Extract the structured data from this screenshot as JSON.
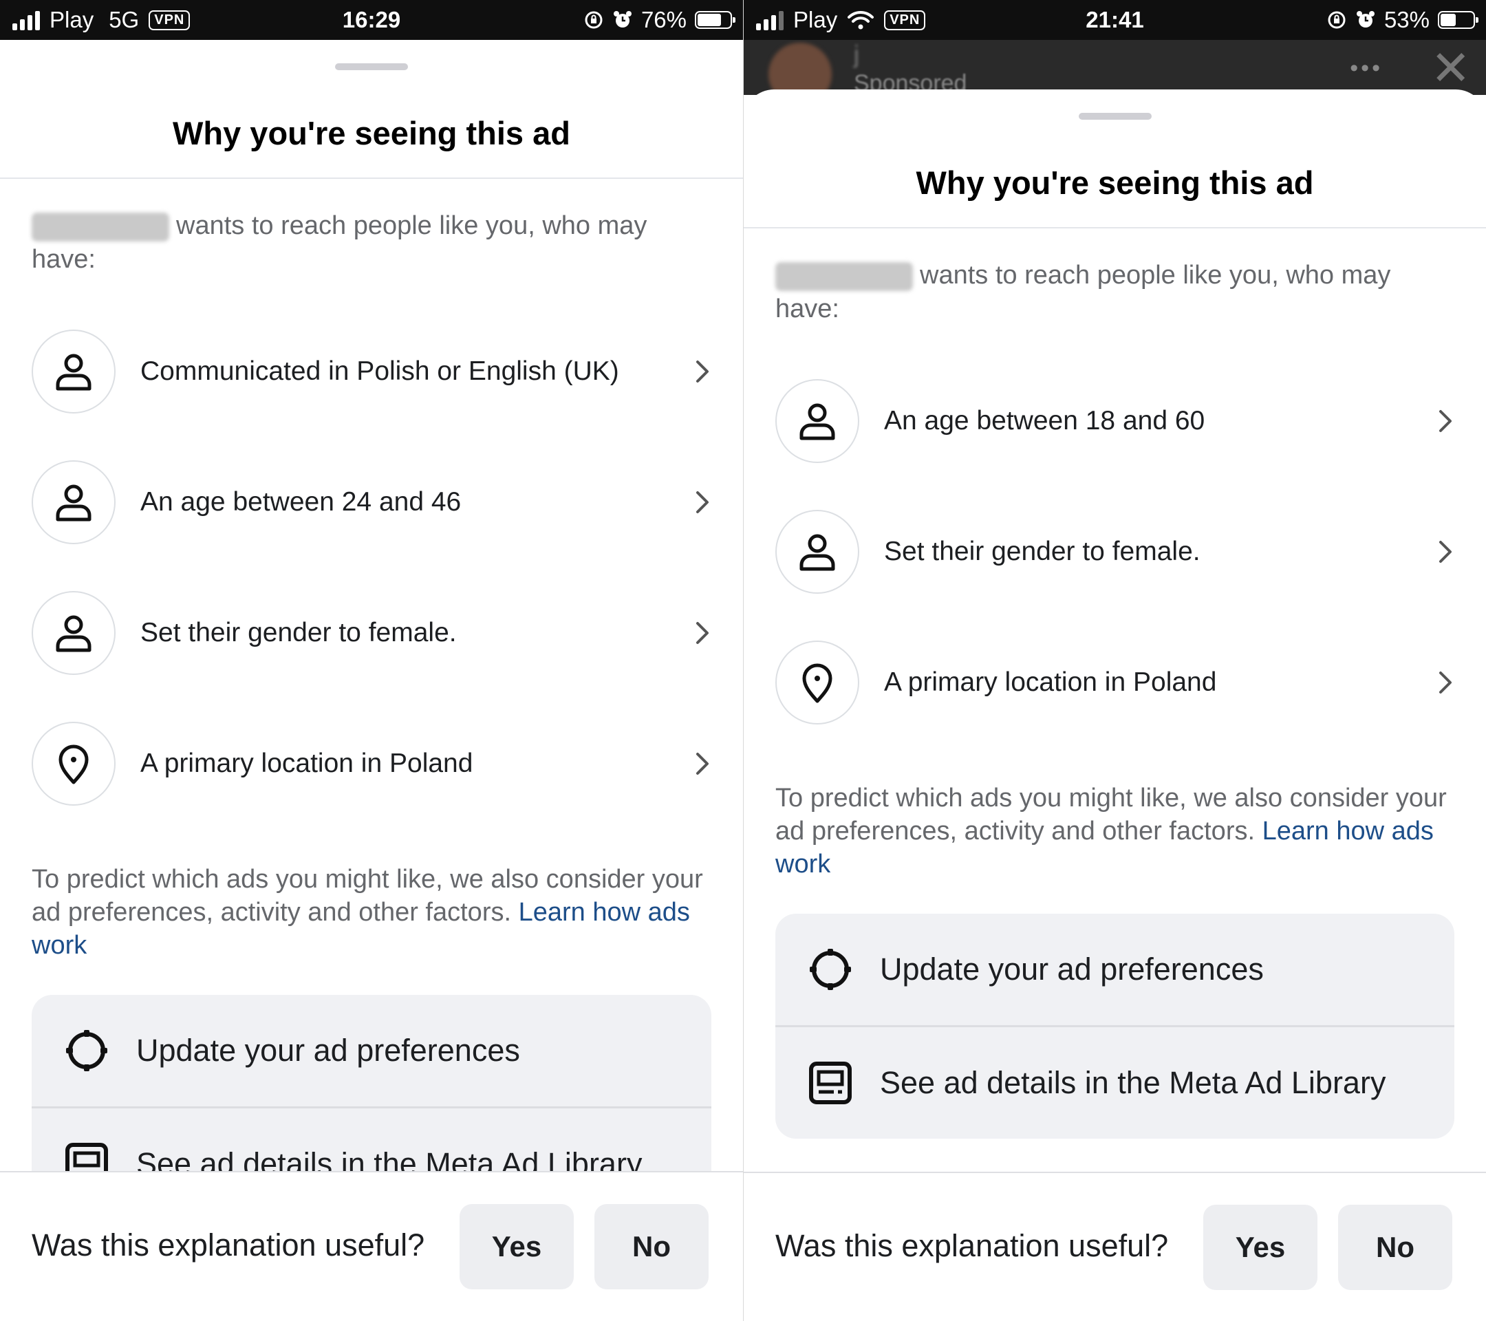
{
  "left": {
    "status": {
      "carrier": "Play",
      "network": "5G",
      "vpn": "VPN",
      "time": "16:29",
      "battery_text": "76%",
      "battery_level": 0.76
    },
    "sheet": {
      "title": "Why you're seeing this ad",
      "intro": "wants to reach people like you, who may have:",
      "reasons": [
        {
          "label": "Communicated in Polish or English (UK)",
          "icon": "person-icon"
        },
        {
          "label": "An age between 24 and 46",
          "icon": "person-icon"
        },
        {
          "label": "Set their gender to female.",
          "icon": "person-icon"
        },
        {
          "label": "A primary location in Poland",
          "icon": "location-pin-icon"
        }
      ],
      "consider_text": "To predict which ads you might like, we also consider your ad preferences, activity and other factors.",
      "learn_link": "Learn how ads work",
      "actions": [
        {
          "label": "Update your ad preferences",
          "icon": "gear-icon"
        },
        {
          "label": "See ad details in the Meta Ad Library",
          "icon": "ad-library-icon"
        }
      ],
      "feedback": {
        "question": "Was this explanation useful?",
        "yes": "Yes",
        "no": "No"
      }
    }
  },
  "right": {
    "status": {
      "carrier": "Play",
      "vpn": "VPN",
      "time": "21:41",
      "battery_text": "53%",
      "battery_level": 0.53
    },
    "background_post": {
      "name_initial": "j",
      "sponsored": "Sponsored"
    },
    "sheet": {
      "title": "Why you're seeing this ad",
      "intro": "wants to reach people like you, who may have:",
      "reasons": [
        {
          "label": "An age between 18 and 60",
          "icon": "person-icon"
        },
        {
          "label": "Set their gender to female.",
          "icon": "person-icon"
        },
        {
          "label": "A primary location in Poland",
          "icon": "location-pin-icon"
        }
      ],
      "consider_text": "To predict which ads you might like, we also consider your ad preferences, activity and other factors.",
      "learn_link": "Learn how ads work",
      "actions": [
        {
          "label": "Update your ad preferences",
          "icon": "gear-icon"
        },
        {
          "label": "See ad details in the Meta Ad Library",
          "icon": "ad-library-icon"
        }
      ],
      "feedback": {
        "question": "Was this explanation useful?",
        "yes": "Yes",
        "no": "No"
      }
    }
  }
}
